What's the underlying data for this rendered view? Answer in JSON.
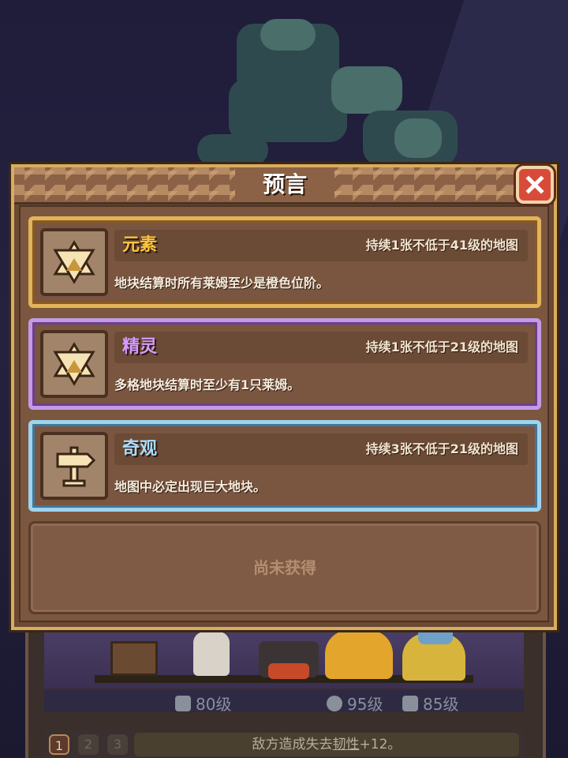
{
  "dialog": {
    "title": "预言"
  },
  "prophecies": [
    {
      "name": "元素",
      "condition": "持续1张不低于41级的地图",
      "description": "地块结算时所有莱姆至少是橙色位阶。",
      "icon": "hexagram-icon",
      "rarity_color": "#e3b35a",
      "name_color": "#ffc43c"
    },
    {
      "name": "精灵",
      "condition": "持续1张不低于21级的地图",
      "description": "多格地块结算时至少有1只莱姆。",
      "icon": "hexagram-icon",
      "rarity_color": "#c49ae8",
      "name_color": "#d79bff"
    },
    {
      "name": "奇观",
      "condition": "持续3张不低于21级的地图",
      "description": "地图中必定出现巨大地块。",
      "icon": "signpost-icon",
      "rarity_color": "#9fd3ee",
      "name_color": "#a9dcff"
    }
  ],
  "empty_slot": {
    "label": "尚未获得"
  },
  "background": {
    "stats": [
      {
        "icon": "dice-icon",
        "label": "80级"
      },
      {
        "icon": "key-icon",
        "label": "95级"
      },
      {
        "icon": "boot-icon",
        "label": "85级"
      }
    ],
    "pages": [
      "1",
      "2",
      "3"
    ],
    "hint": {
      "before": "敌方造成失去",
      "underlined": "韧性",
      "after": "+12。"
    }
  }
}
